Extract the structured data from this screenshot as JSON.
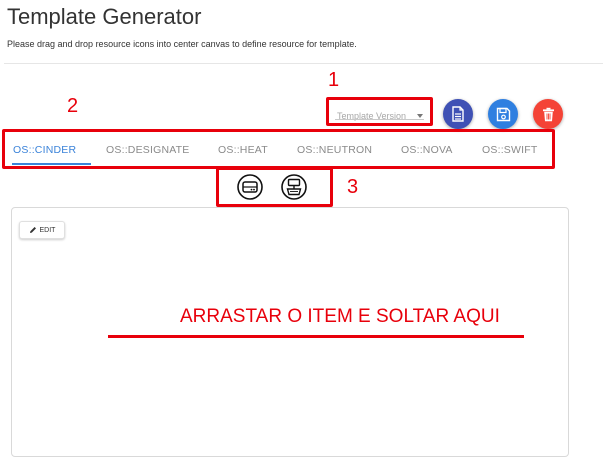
{
  "header": {
    "title": "Template Generator",
    "subtitle": "Please drag and drop resource icons into center canvas to define resource for template."
  },
  "annotations": {
    "n1": "1",
    "n2": "2",
    "n3": "3",
    "drop_text": "ARRASTAR O ITEM E SOLTAR AQUI",
    "color": "#e8000b"
  },
  "version_select": {
    "placeholder": "Template Version"
  },
  "actions": {
    "new_icon": "file-icon",
    "save_icon": "save-icon",
    "delete_icon": "trash-icon",
    "new_color": "#3f51b5",
    "save_color": "#2f7fe0",
    "delete_color": "#f44336"
  },
  "tabs": [
    {
      "label": "OS::CINDER",
      "active": true
    },
    {
      "label": "OS::DESIGNATE",
      "active": false
    },
    {
      "label": "OS::HEAT",
      "active": false
    },
    {
      "label": "OS::NEUTRON",
      "active": false
    },
    {
      "label": "OS::NOVA",
      "active": false
    },
    {
      "label": "OS::SWIFT",
      "active": false
    }
  ],
  "resource_icons": [
    "volume-icon",
    "volume-attachment-icon"
  ],
  "canvas": {
    "edit_label": "EDIT",
    "edit_icon": "pencil-icon"
  },
  "colors": {
    "accent": "#3b83d9"
  }
}
